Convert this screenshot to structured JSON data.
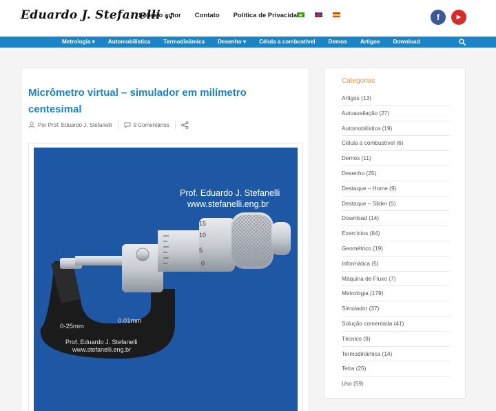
{
  "header": {
    "logo": "Eduardo J. Stefanelli .:",
    "nav": [
      "Sobre o autor",
      "Contato",
      "Política de Privacidade"
    ]
  },
  "main_nav": {
    "items": [
      "Metrologia ▾",
      "Automobilística",
      "Termodinâmica",
      "Desenho ▾",
      "Célula a combustível",
      "Demos",
      "Artigos",
      "Download"
    ]
  },
  "post": {
    "title": "Micrômetro virtual – simulador em milímetro centesimal",
    "author": "Por Prof. Eduardo J. Stefanelli",
    "comments": "9 Comentários",
    "image": {
      "line1": "Prof. Eduardo J. Stefanelli",
      "line2": "www.stefanelli.eng.br",
      "range": "0-25mm",
      "resolution": "0.01mm",
      "frame_line1": "Prof. Eduardo J. Stefanelli",
      "frame_line2": "www.stefanelli.eng.br",
      "scale": [
        "15",
        "10",
        "5",
        "0"
      ]
    }
  },
  "sidebar": {
    "heading": "Categorias",
    "categories": [
      "Artigos (13)",
      "Autoavaliação (27)",
      "Automobilística (19)",
      "Célula a combustível (6)",
      "Demos (11)",
      "Desenho (25)",
      "Destaque – Home (9)",
      "Destaque – Slider (5)",
      "Download (14)",
      "Exercícios (84)",
      "Geométrico (19)",
      "Informática (5)",
      "Máquina de Fluxo (7)",
      "Metrologia (179)",
      "Simulador (37)",
      "Solução comentada (41)",
      "Técnico (9)",
      "Termodinâmica (14)",
      "Tetra (25)",
      "Uso (59)"
    ]
  },
  "icons": {
    "facebook": "facebook-icon",
    "youtube": "youtube-icon",
    "search": "search-icon",
    "user": "user-icon",
    "comment": "comment-icon",
    "share": "share-icon"
  },
  "colors": {
    "accent": "#1b85c8",
    "heading_orange": "#e7962f",
    "image_bg": "#1e58a5"
  }
}
